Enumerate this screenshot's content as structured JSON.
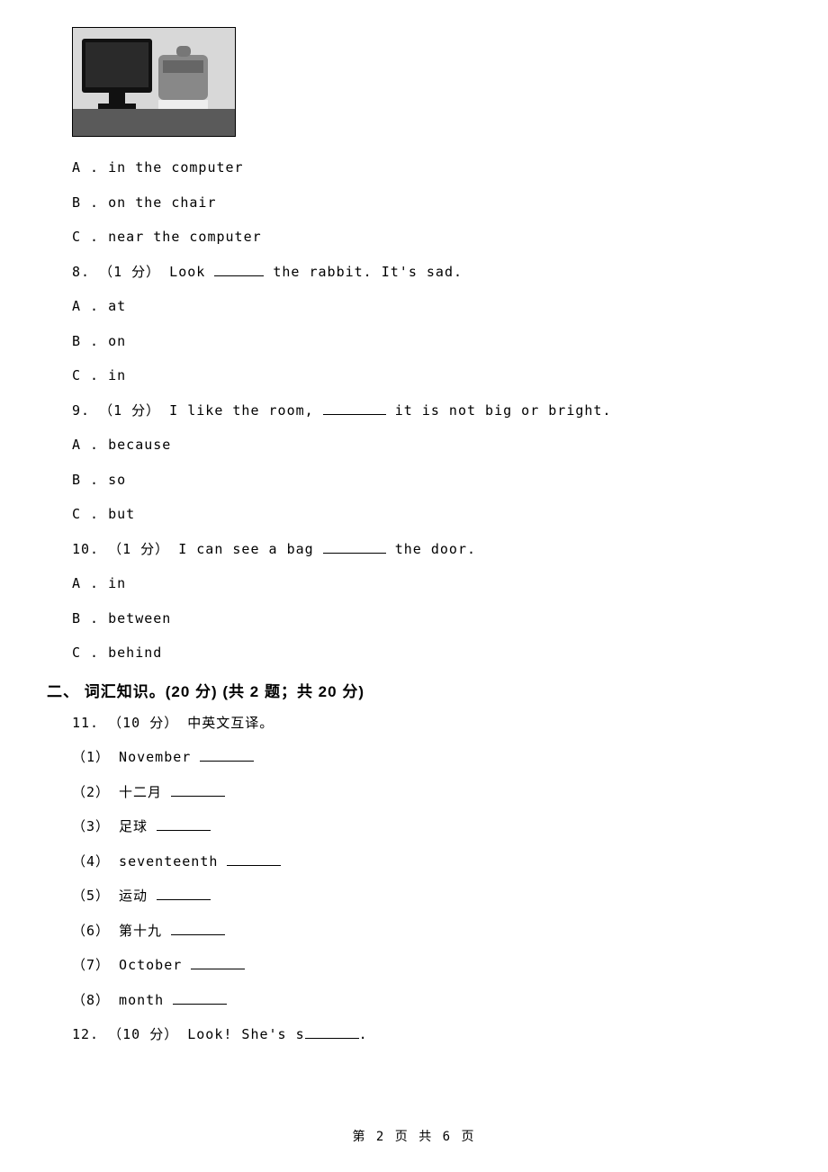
{
  "q7": {
    "optA": "A . in the computer",
    "optB": "B . on the chair",
    "optC": "C . near the computer"
  },
  "q8": {
    "head_pre": "8. （1 分） Look ",
    "head_post": " the rabbit. It's sad.",
    "optA": "A . at",
    "optB": "B . on",
    "optC": "C . in"
  },
  "q9": {
    "head_pre": "9. （1 分） I like the room, ",
    "head_post": " it is not big or bright.",
    "optA": "A . because",
    "optB": "B . so",
    "optC": "C . but"
  },
  "q10": {
    "head_pre": "10. （1 分） I can see a bag ",
    "head_post": " the door.",
    "optA": "A . in",
    "optB": "B . between",
    "optC": "C . behind"
  },
  "section2": {
    "heading": "二、 词汇知识。(20 分) (共 2 题；共 20 分)"
  },
  "q11": {
    "head": "11. （10 分） 中英文互译。",
    "s1": "（1） November ",
    "s2": "（2） 十二月 ",
    "s3": "（3） 足球 ",
    "s4": "（4） seventeenth ",
    "s5": "（5） 运动 ",
    "s6": "（6） 第十九 ",
    "s7": "（7） October ",
    "s8": "（8） month "
  },
  "q12": {
    "head_pre": "12. （10 分） Look! She's s",
    "head_post": "."
  },
  "footer": "第 2 页 共 6 页"
}
